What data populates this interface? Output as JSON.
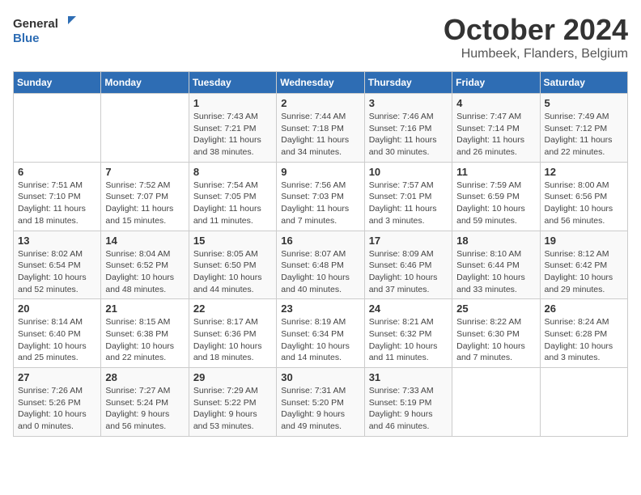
{
  "header": {
    "logo": {
      "general": "General",
      "blue": "Blue"
    },
    "title": "October 2024",
    "location": "Humbeek, Flanders, Belgium"
  },
  "days_of_week": [
    "Sunday",
    "Monday",
    "Tuesday",
    "Wednesday",
    "Thursday",
    "Friday",
    "Saturday"
  ],
  "weeks": [
    [
      {
        "day": "",
        "info": ""
      },
      {
        "day": "",
        "info": ""
      },
      {
        "day": "1",
        "info": "Sunrise: 7:43 AM\nSunset: 7:21 PM\nDaylight: 11 hours and 38 minutes."
      },
      {
        "day": "2",
        "info": "Sunrise: 7:44 AM\nSunset: 7:18 PM\nDaylight: 11 hours and 34 minutes."
      },
      {
        "day": "3",
        "info": "Sunrise: 7:46 AM\nSunset: 7:16 PM\nDaylight: 11 hours and 30 minutes."
      },
      {
        "day": "4",
        "info": "Sunrise: 7:47 AM\nSunset: 7:14 PM\nDaylight: 11 hours and 26 minutes."
      },
      {
        "day": "5",
        "info": "Sunrise: 7:49 AM\nSunset: 7:12 PM\nDaylight: 11 hours and 22 minutes."
      }
    ],
    [
      {
        "day": "6",
        "info": "Sunrise: 7:51 AM\nSunset: 7:10 PM\nDaylight: 11 hours and 18 minutes."
      },
      {
        "day": "7",
        "info": "Sunrise: 7:52 AM\nSunset: 7:07 PM\nDaylight: 11 hours and 15 minutes."
      },
      {
        "day": "8",
        "info": "Sunrise: 7:54 AM\nSunset: 7:05 PM\nDaylight: 11 hours and 11 minutes."
      },
      {
        "day": "9",
        "info": "Sunrise: 7:56 AM\nSunset: 7:03 PM\nDaylight: 11 hours and 7 minutes."
      },
      {
        "day": "10",
        "info": "Sunrise: 7:57 AM\nSunset: 7:01 PM\nDaylight: 11 hours and 3 minutes."
      },
      {
        "day": "11",
        "info": "Sunrise: 7:59 AM\nSunset: 6:59 PM\nDaylight: 10 hours and 59 minutes."
      },
      {
        "day": "12",
        "info": "Sunrise: 8:00 AM\nSunset: 6:56 PM\nDaylight: 10 hours and 56 minutes."
      }
    ],
    [
      {
        "day": "13",
        "info": "Sunrise: 8:02 AM\nSunset: 6:54 PM\nDaylight: 10 hours and 52 minutes."
      },
      {
        "day": "14",
        "info": "Sunrise: 8:04 AM\nSunset: 6:52 PM\nDaylight: 10 hours and 48 minutes."
      },
      {
        "day": "15",
        "info": "Sunrise: 8:05 AM\nSunset: 6:50 PM\nDaylight: 10 hours and 44 minutes."
      },
      {
        "day": "16",
        "info": "Sunrise: 8:07 AM\nSunset: 6:48 PM\nDaylight: 10 hours and 40 minutes."
      },
      {
        "day": "17",
        "info": "Sunrise: 8:09 AM\nSunset: 6:46 PM\nDaylight: 10 hours and 37 minutes."
      },
      {
        "day": "18",
        "info": "Sunrise: 8:10 AM\nSunset: 6:44 PM\nDaylight: 10 hours and 33 minutes."
      },
      {
        "day": "19",
        "info": "Sunrise: 8:12 AM\nSunset: 6:42 PM\nDaylight: 10 hours and 29 minutes."
      }
    ],
    [
      {
        "day": "20",
        "info": "Sunrise: 8:14 AM\nSunset: 6:40 PM\nDaylight: 10 hours and 25 minutes."
      },
      {
        "day": "21",
        "info": "Sunrise: 8:15 AM\nSunset: 6:38 PM\nDaylight: 10 hours and 22 minutes."
      },
      {
        "day": "22",
        "info": "Sunrise: 8:17 AM\nSunset: 6:36 PM\nDaylight: 10 hours and 18 minutes."
      },
      {
        "day": "23",
        "info": "Sunrise: 8:19 AM\nSunset: 6:34 PM\nDaylight: 10 hours and 14 minutes."
      },
      {
        "day": "24",
        "info": "Sunrise: 8:21 AM\nSunset: 6:32 PM\nDaylight: 10 hours and 11 minutes."
      },
      {
        "day": "25",
        "info": "Sunrise: 8:22 AM\nSunset: 6:30 PM\nDaylight: 10 hours and 7 minutes."
      },
      {
        "day": "26",
        "info": "Sunrise: 8:24 AM\nSunset: 6:28 PM\nDaylight: 10 hours and 3 minutes."
      }
    ],
    [
      {
        "day": "27",
        "info": "Sunrise: 7:26 AM\nSunset: 5:26 PM\nDaylight: 10 hours and 0 minutes."
      },
      {
        "day": "28",
        "info": "Sunrise: 7:27 AM\nSunset: 5:24 PM\nDaylight: 9 hours and 56 minutes."
      },
      {
        "day": "29",
        "info": "Sunrise: 7:29 AM\nSunset: 5:22 PM\nDaylight: 9 hours and 53 minutes."
      },
      {
        "day": "30",
        "info": "Sunrise: 7:31 AM\nSunset: 5:20 PM\nDaylight: 9 hours and 49 minutes."
      },
      {
        "day": "31",
        "info": "Sunrise: 7:33 AM\nSunset: 5:19 PM\nDaylight: 9 hours and 46 minutes."
      },
      {
        "day": "",
        "info": ""
      },
      {
        "day": "",
        "info": ""
      }
    ]
  ]
}
